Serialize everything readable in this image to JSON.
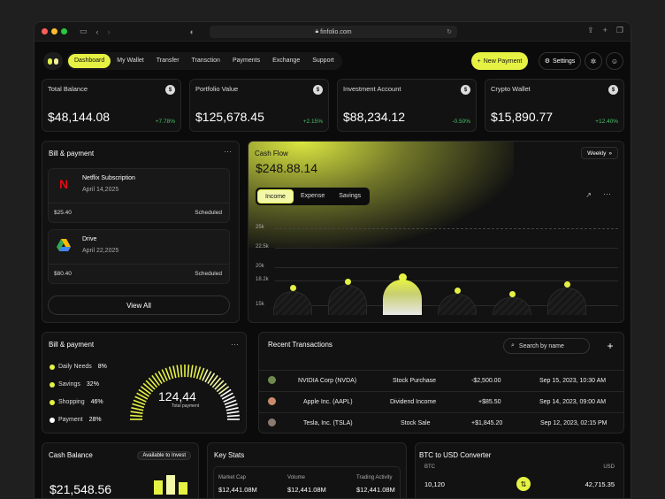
{
  "browser": {
    "url": "finfolio.com"
  },
  "nav": {
    "tabs": [
      "Dashboard",
      "My Wallet",
      "Transfer",
      "Transction",
      "Payments",
      "Exchange",
      "Support"
    ],
    "new_payment": "New Payment",
    "settings": "Settings"
  },
  "stats": [
    {
      "label": "Total Balance",
      "value": "$48,144.08",
      "change": "+7.78%"
    },
    {
      "label": "Portfolio Value",
      "value": "$125,678.45",
      "change": "+2.15%"
    },
    {
      "label": "Investment Account",
      "value": "$88,234.12",
      "change": "-0.50%"
    },
    {
      "label": "Crypto Wallet",
      "value": "$15,890.77",
      "change": "+12.40%"
    }
  ],
  "bills": {
    "title": "Bill & payment",
    "items": [
      {
        "name": "Netflix Subscription",
        "date": "April 14,2025",
        "amount": "$25.40",
        "status": "Scheduled",
        "icon": "netflix-icon"
      },
      {
        "name": "Drive",
        "date": "April 22,2025",
        "amount": "$80.40",
        "status": "Scheduled",
        "icon": "drive-icon"
      }
    ],
    "view_all": "View All"
  },
  "cashflow": {
    "title": "Cash Flow",
    "value": "$248.88.14",
    "segments": [
      "Income",
      "Expense",
      "Savings"
    ],
    "period": "Weekly"
  },
  "chart_data": {
    "type": "bar",
    "y_ticks": [
      "25k",
      "22.5k",
      "20k",
      "18.2k",
      "15k"
    ],
    "values": [
      16.6,
      17.4,
      18.1,
      16.3,
      15.8,
      17.1
    ],
    "highlight_index": 2,
    "ylim": [
      13.5,
      25.5
    ]
  },
  "gauge": {
    "title": "Bill & payment",
    "legend": [
      {
        "label": "Daily Needs",
        "pct": "8%",
        "color": "#e6f243"
      },
      {
        "label": "Savings",
        "pct": "32%",
        "color": "#e6f243"
      },
      {
        "label": "Shopping",
        "pct": "46%",
        "color": "#e6f243"
      },
      {
        "label": "Payment",
        "pct": "28%",
        "color": "#ffffff"
      }
    ],
    "value": "124,44",
    "sub": "Total payment"
  },
  "transactions": {
    "title": "Recent Transactions",
    "search_placeholder": "Search by name",
    "rows": [
      {
        "company": "NVIDIA Corp (NVDA)",
        "type": "Stock Purchase",
        "amount": "-$2,500.00",
        "date": "Sep 15, 2023, 10:30 AM"
      },
      {
        "company": "Apple Inc. (AAPL)",
        "type": "Dividend Income",
        "amount": "+$85.50",
        "date": "Sep 14, 2023, 09:00 AM"
      },
      {
        "company": "Tesla, Inc. (TSLA)",
        "type": "Stock Sale",
        "amount": "+$1,845.20",
        "date": "Sep 12, 2023, 02:15 PM"
      }
    ]
  },
  "cash_balance": {
    "title": "Cash Balance",
    "badge": "Available to Invest",
    "value": "$21,548.56"
  },
  "key_stats": {
    "title": "Key Stats",
    "cols": [
      {
        "label": "Market Cap",
        "value": "$12,441.08M"
      },
      {
        "label": "Volume",
        "value": "$12,441.08M"
      },
      {
        "label": "Trading Activity",
        "value": "$12,441.08M"
      }
    ]
  },
  "converter": {
    "title": "BTC to USD Converter",
    "from": "BTC",
    "to": "USD",
    "from_val": "10,120",
    "to_val": "42,715.35"
  }
}
